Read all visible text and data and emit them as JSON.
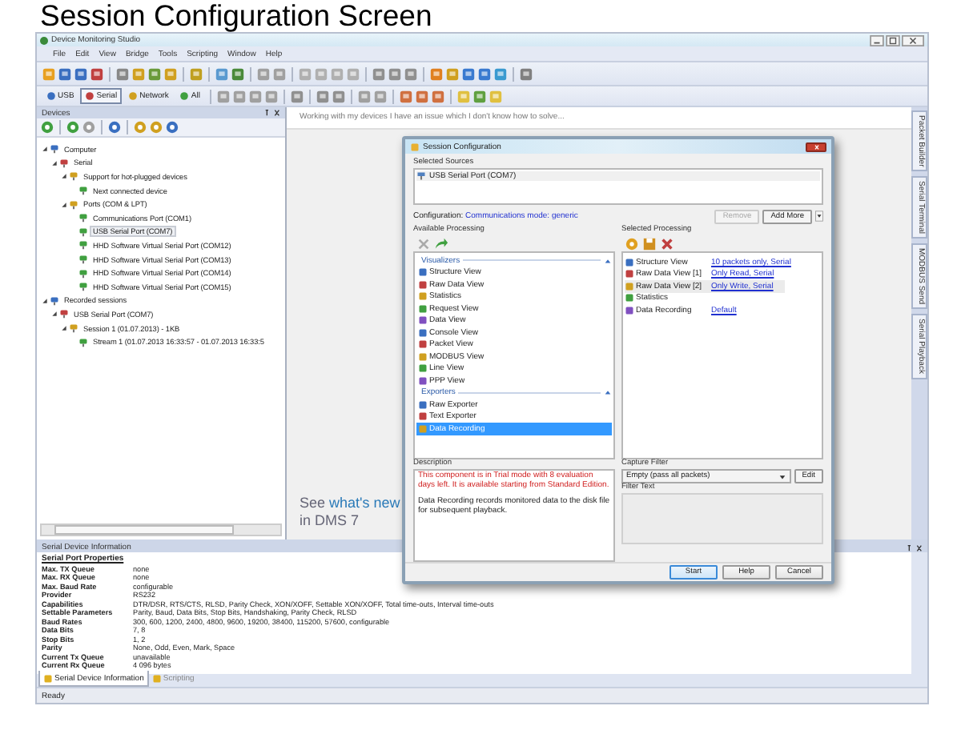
{
  "heading": "Session Configuration Screen",
  "window": {
    "title": "Device Monitoring Studio"
  },
  "menu": [
    "File",
    "Edit",
    "View",
    "Bridge",
    "Tools",
    "Scripting",
    "Window",
    "Help"
  ],
  "source_tabs": [
    {
      "label": "USB",
      "selected": false
    },
    {
      "label": "Serial",
      "selected": true
    },
    {
      "label": "Network",
      "selected": false
    },
    {
      "label": "All",
      "selected": false
    }
  ],
  "devices_panel": {
    "title": "Devices",
    "tree": [
      {
        "label": "Computer",
        "expanded": true,
        "selected": false,
        "children": [
          {
            "label": "Serial",
            "expanded": true,
            "selected": false,
            "children": [
              {
                "label": "Support for hot-plugged devices",
                "expanded": true,
                "selected": false,
                "children": [
                  {
                    "label": "Next connected device",
                    "selected": false
                  }
                ]
              },
              {
                "label": "Ports (COM & LPT)",
                "expanded": true,
                "selected": false,
                "children": [
                  {
                    "label": "Communications Port (COM1)",
                    "selected": false
                  },
                  {
                    "label": "USB Serial Port (COM7)",
                    "selected": true
                  },
                  {
                    "label": "HHD Software Virtual Serial Port (COM12)",
                    "selected": false
                  },
                  {
                    "label": "HHD Software Virtual Serial Port (COM13)",
                    "selected": false
                  },
                  {
                    "label": "HHD Software Virtual Serial Port (COM14)",
                    "selected": false
                  },
                  {
                    "label": "HHD Software Virtual Serial Port (COM15)",
                    "selected": false
                  }
                ]
              }
            ]
          }
        ]
      },
      {
        "label": "Recorded sessions",
        "expanded": true,
        "selected": false,
        "children": [
          {
            "label": "USB Serial Port (COM7)",
            "expanded": true,
            "selected": false,
            "children": [
              {
                "label": "Session 1 (01.07.2013) - 1KB",
                "expanded": true,
                "selected": false,
                "children": [
                  {
                    "label": "Stream 1 (01.07.2013 16:33:57 - 01.07.2013 16:33:5",
                    "selected": false
                  }
                ]
              }
            ]
          }
        ]
      }
    ]
  },
  "hint": "Working with my devices I have an issue which I don't know how to solve...",
  "promo": {
    "prefix": "See",
    "link": "what's new",
    "line2": "in DMS 7"
  },
  "side_tabs": [
    "Packet Builder",
    "Serial Terminal",
    "MODBUS Send",
    "Serial Playback"
  ],
  "dialog": {
    "title": "Session Configuration",
    "sources_label": "Selected Sources",
    "sources": [
      "USB Serial Port (COM7)"
    ],
    "configuration_label": "Configuration:",
    "configuration": "Communications mode: generic",
    "buttons_top": [
      {
        "label": "Remove",
        "disabled": true
      },
      {
        "label": "Add More",
        "disabled": false
      }
    ],
    "available_label": "Available Processing",
    "groups": [
      {
        "title": "Visualizers",
        "items": [
          {
            "label": "Structure View",
            "selected": false
          },
          {
            "label": "Raw Data View",
            "selected": false
          },
          {
            "label": "Statistics",
            "selected": false
          },
          {
            "label": "Request View",
            "selected": false
          },
          {
            "label": "Data View",
            "selected": false
          },
          {
            "label": "Console View",
            "selected": false
          },
          {
            "label": "Packet View",
            "selected": false
          },
          {
            "label": "MODBUS View",
            "selected": false
          },
          {
            "label": "Line View",
            "selected": false
          },
          {
            "label": "PPP View",
            "selected": false
          }
        ]
      },
      {
        "title": "Exporters",
        "items": [
          {
            "label": "Raw Exporter",
            "selected": false
          },
          {
            "label": "Text Exporter",
            "selected": false
          },
          {
            "label": "Data Recording",
            "selected": true
          }
        ]
      }
    ],
    "selected_label": "Selected Processing",
    "selected_items": [
      {
        "name": "Structure View",
        "setting": "10 packets only, Serial",
        "selected": false
      },
      {
        "name": "Raw Data View [1]",
        "setting": "Only Read, Serial",
        "selected": false
      },
      {
        "name": "Raw Data View [2]",
        "setting": "Only Write, Serial",
        "selected": true
      },
      {
        "name": "Statistics",
        "selected": false
      },
      {
        "name": "Data Recording",
        "setting": "Default",
        "selected": false
      }
    ],
    "description_label": "Description",
    "warning": "This component is in Trial mode with 8 evaluation days left. It is available starting from Standard Edition.",
    "description": "Data Recording records monitored data to the disk file for subsequent playback.",
    "capture_label": "Capture Filter",
    "capture_value": "Empty (pass all packets)",
    "edit_button": "Edit",
    "filter_label": "Filter Text",
    "buttons": [
      {
        "label": "Start",
        "default": true
      },
      {
        "label": "Help",
        "default": false
      },
      {
        "label": "Cancel",
        "default": false
      }
    ]
  },
  "info_panel": {
    "title": "Serial Device Information",
    "section": "Serial Port Properties",
    "rows": [
      {
        "name": "Max. TX Queue",
        "value": "none"
      },
      {
        "name": "Max. RX Queue",
        "value": "none"
      },
      {
        "name": "Max. Baud Rate",
        "value": "configurable"
      },
      {
        "name": "Provider",
        "value": "RS232"
      },
      {
        "name": "Capabilities",
        "value": "DTR/DSR, RTS/CTS, RLSD, Parity Check, XON/XOFF, Settable XON/XOFF, Total time-outs, Interval time-outs"
      },
      {
        "name": "Settable Parameters",
        "value": "Parity, Baud, Data Bits, Stop Bits, Handshaking, Parity Check, RLSD"
      },
      {
        "name": "Baud Rates",
        "value": "300, 600, 1200, 2400, 4800, 9600, 19200, 38400, 115200, 57600, configurable"
      },
      {
        "name": "Data Bits",
        "value": "7, 8"
      },
      {
        "name": "Stop Bits",
        "value": "1, 2"
      },
      {
        "name": "Parity",
        "value": "None, Odd, Even, Mark, Space"
      },
      {
        "name": "Current Tx Queue",
        "value": "unavailable"
      },
      {
        "name": "Current Rx Queue",
        "value": "4 096 bytes"
      }
    ]
  },
  "bottom_tabs": [
    {
      "label": "Serial Device Information",
      "selected": true
    },
    {
      "label": "Scripting",
      "selected": false
    }
  ],
  "status_bar": "Ready"
}
